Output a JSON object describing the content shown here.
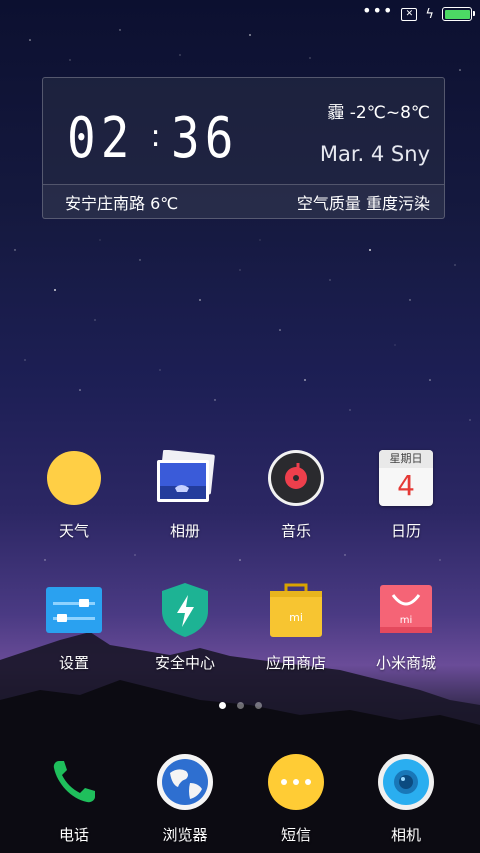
{
  "status_bar": {
    "battery_level": 1.0,
    "battery_color": "#4cd964",
    "icons": [
      "signal-dots-icon",
      "no-sim-icon",
      "charging-icon",
      "battery-icon"
    ],
    "no_sim_symbol": "✕",
    "dots": "•••",
    "bolt": "ϟ"
  },
  "widget": {
    "hours": "02",
    "colon": ":",
    "minutes": "36",
    "weather_temp": "霾 -2℃~8℃",
    "date": "Mar. 4 Sny",
    "location": "安宁庄南路 6℃",
    "air_quality": "空气质量 重度污染"
  },
  "apps": {
    "row1": [
      {
        "label": "天气",
        "icon": "weather-icon"
      },
      {
        "label": "相册",
        "icon": "gallery-icon"
      },
      {
        "label": "音乐",
        "icon": "music-icon"
      },
      {
        "label": "日历",
        "icon": "calendar-icon",
        "calendar_header": "星期日",
        "calendar_day": "4"
      }
    ],
    "row2": [
      {
        "label": "设置",
        "icon": "settings-icon"
      },
      {
        "label": "安全中心",
        "icon": "security-icon"
      },
      {
        "label": "应用商店",
        "icon": "app-store-icon"
      },
      {
        "label": "小米商城",
        "icon": "mi-store-icon"
      }
    ]
  },
  "page_indicator": {
    "count": 3,
    "active": 0
  },
  "dock": [
    {
      "label": "电话",
      "icon": "phone-icon"
    },
    {
      "label": "浏览器",
      "icon": "browser-icon"
    },
    {
      "label": "短信",
      "icon": "messages-icon"
    },
    {
      "label": "相机",
      "icon": "camera-icon"
    }
  ],
  "brand_mark": "mi"
}
